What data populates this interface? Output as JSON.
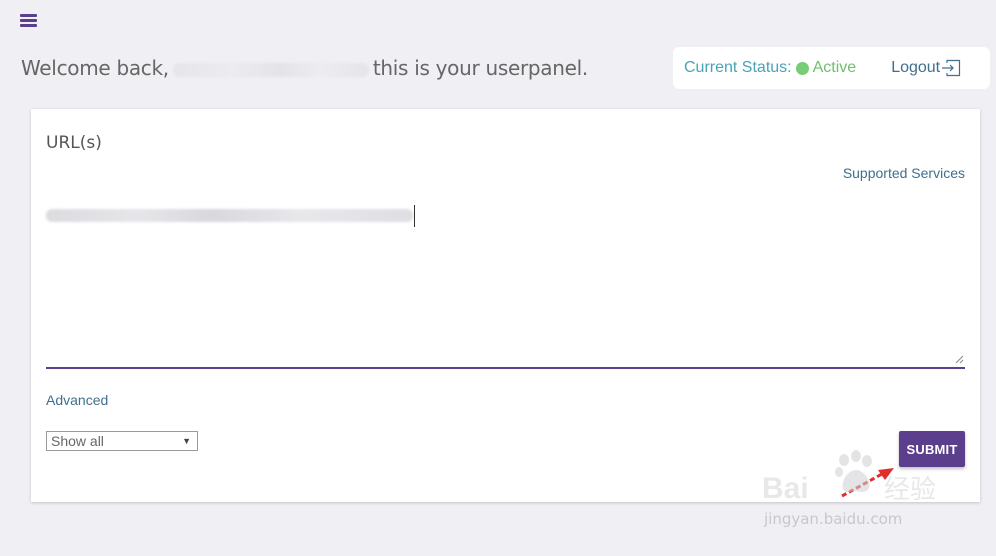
{
  "header": {
    "menu_icon": "hamburger-menu-icon",
    "welcome_prefix": "Welcome back,",
    "welcome_suffix": "this is your userpanel."
  },
  "status": {
    "label": "Current Status:",
    "value": "Active",
    "status_color": "#77cc77",
    "logout_label": "Logout",
    "logout_icon": "logout-icon"
  },
  "form": {
    "title": "URL(s)",
    "supported_services_label": "Supported Services",
    "advanced_label": "Advanced",
    "filter_selected": "Show all",
    "submit_label": "SUBMIT"
  },
  "watermark": {
    "brand": "Bai",
    "brand_cn": "经验",
    "url": "jingyan.baidu.com"
  },
  "colors": {
    "accent": "#5b3f8c",
    "link": "#3f6f8c",
    "status_label": "#4aa3b8",
    "background": "#efeff4"
  }
}
